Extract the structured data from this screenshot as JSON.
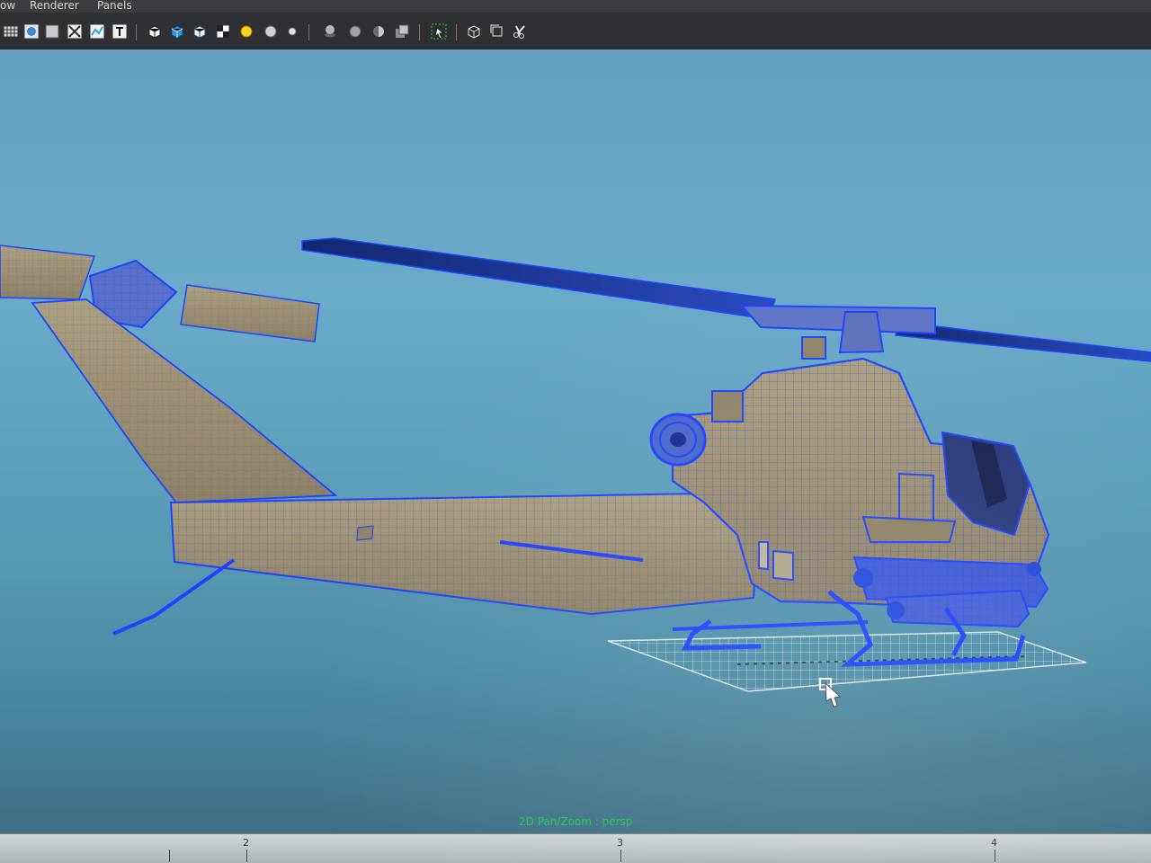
{
  "menu": {
    "items": [
      "ow",
      "Renderer",
      "Panels"
    ]
  },
  "toolbar": {
    "tools": [
      "grid-icon",
      "shaded-sphere-icon",
      "square-icon",
      "wireframe-box-icon",
      "texture-icon",
      "text-icon",
      "cube-wire-icon",
      "cube-shaded-icon",
      "cube-textured-icon",
      "checker-icon",
      "light-yellow-icon",
      "light-gray-icon",
      "light-small-icon",
      "shadow-light-icon",
      "sphere-icon",
      "half-sphere-icon",
      "material-icon",
      "select-highlight-icon",
      "cube-outline-icon",
      "box-frame-icon",
      "scissors-icon"
    ]
  },
  "viewport": {
    "hud_text": "2D Pan/Zoom : persp",
    "background_top": "#64a2bf",
    "background_bottom": "#3d6f86",
    "wire_color": "#1f43ff",
    "mesh_fill": "#9d9172",
    "ground_grid_color": "#d8dfe4",
    "cursor": "select-cursor-icon"
  },
  "timeline": {
    "ticks": [
      "2",
      "3",
      "4"
    ]
  }
}
